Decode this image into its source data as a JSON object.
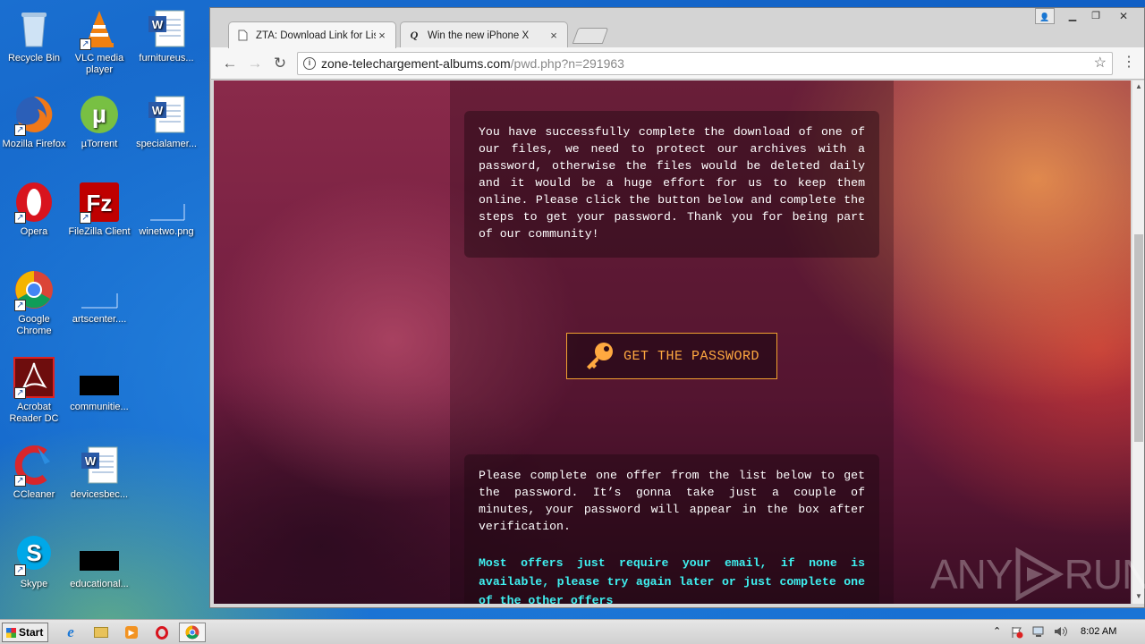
{
  "desktop": {
    "icons": [
      {
        "label": "Recycle Bin",
        "icon": "recycle-bin-icon"
      },
      {
        "label": "VLC media player",
        "icon": "vlc-icon"
      },
      {
        "label": "furnitureus...",
        "icon": "word-doc-icon"
      },
      {
        "label": "Mozilla Firefox",
        "icon": "firefox-icon"
      },
      {
        "label": "µTorrent",
        "icon": "utorrent-icon"
      },
      {
        "label": "specialamer...",
        "icon": "word-doc-icon"
      },
      {
        "label": "Opera",
        "icon": "opera-icon"
      },
      {
        "label": "FileZilla Client",
        "icon": "filezilla-icon"
      },
      {
        "label": "winetwo.png",
        "icon": "image-file-icon"
      },
      {
        "label": "Google Chrome",
        "icon": "chrome-icon"
      },
      {
        "label": "artscenter....",
        "icon": "image-file-icon"
      },
      {
        "label": "Acrobat Reader DC",
        "icon": "acrobat-icon"
      },
      {
        "label": "communitie...",
        "icon": "black-file-icon"
      },
      {
        "label": "CCleaner",
        "icon": "ccleaner-icon"
      },
      {
        "label": "devicesbec...",
        "icon": "word-doc-icon"
      },
      {
        "label": "Skype",
        "icon": "skype-icon"
      },
      {
        "label": "educational...",
        "icon": "black-file-icon"
      }
    ]
  },
  "browser": {
    "tabs": [
      {
        "title": "ZTA: Download Link for Lisa",
        "active": true,
        "close": "×"
      },
      {
        "title": "Win the new iPhone X",
        "active": false,
        "close": "×"
      }
    ],
    "window_buttons": {
      "user": "👤",
      "minimize": "▁",
      "restore": "❐",
      "close": "✕"
    },
    "nav": {
      "back": "←",
      "forward": "→",
      "reload": "↻"
    },
    "url": {
      "host": "zone-telechargement-albums.com",
      "path": "/pwd.php?n=291963"
    },
    "star": "☆",
    "menu": "⋮"
  },
  "page": {
    "intro_text": "You have successfully complete the download of one of our files, we need to protect our archives with a password, otherwise the files would be deleted daily and it would be a huge effort for us to keep them online. Please click the button below and complete the steps to get your password. Thank you for being part of our community!",
    "button_label": "GET THE PASSWORD",
    "offer_text": "Please complete one offer from the list below to get the password. It’s gonna take just a couple of minutes, your password will appear in the box after verification.",
    "offer_note": "Most offers just require your email, if none is available, please try again later or just complete one of the other offers"
  },
  "watermark": {
    "left": "ANY",
    "right": "RUN"
  },
  "taskbar": {
    "start_label": "Start",
    "time": "8:02 AM",
    "tray_up": "⌃"
  },
  "colors": {
    "accent_button": "#ffa940",
    "cyan_note": "#3ff0f0"
  }
}
